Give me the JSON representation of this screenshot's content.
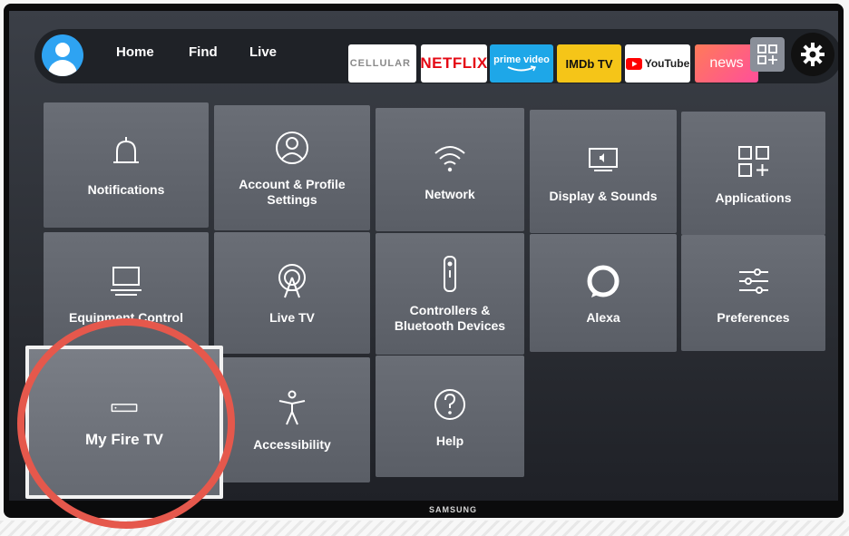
{
  "nav": {
    "links": [
      "Home",
      "Find",
      "Live"
    ],
    "apps": [
      {
        "label": "CELLULAR",
        "bg": "#ffffff",
        "fg": "#8a8a8a"
      },
      {
        "label": "NETFLIX",
        "bg": "#ffffff",
        "fg": "#e50914"
      },
      {
        "label": "prime video",
        "bg": "#1ea7e8",
        "fg": "#ffffff"
      },
      {
        "label": "IMDb TV",
        "bg": "#f5c518",
        "fg": "#111111"
      },
      {
        "label": "YouTube",
        "bg": "#ffffff",
        "fg": "#222222"
      },
      {
        "label": "news",
        "bg": "#ff6f7a",
        "fg": "#ffffff"
      }
    ],
    "all_apps_icon": "apps-grid-icon",
    "settings_icon": "gear-icon"
  },
  "settings_tiles": [
    {
      "label": "Notifications",
      "icon": "bell-icon"
    },
    {
      "label": "Account & Profile Settings",
      "icon": "profile-icon"
    },
    {
      "label": "Network",
      "icon": "wifi-icon"
    },
    {
      "label": "Display & Sounds",
      "icon": "display-icon"
    },
    {
      "label": "Applications",
      "icon": "applications-icon"
    },
    {
      "label": "Equipment Control",
      "icon": "monitor-icon"
    },
    {
      "label": "Live TV",
      "icon": "antenna-icon"
    },
    {
      "label": "Controllers & Bluetooth Devices",
      "icon": "remote-icon"
    },
    {
      "label": "Alexa",
      "icon": "alexa-icon"
    },
    {
      "label": "Preferences",
      "icon": "sliders-icon"
    },
    {
      "label": "My Fire TV",
      "icon": "fire-tv-stick-icon",
      "selected": true
    },
    {
      "label": "Accessibility",
      "icon": "accessibility-icon"
    },
    {
      "label": "Help",
      "icon": "help-icon"
    }
  ],
  "tv_brand": "SAMSUNG",
  "annotation_color": "#e5584c"
}
